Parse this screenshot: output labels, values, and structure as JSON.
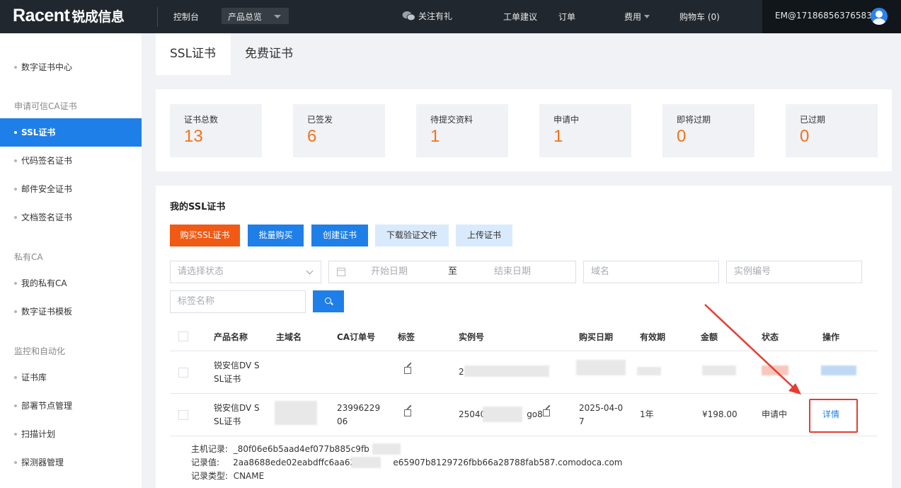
{
  "topbar": {
    "logo_text": "Racent",
    "logo_cn": "锐成信息",
    "console": "控制台",
    "products": "产品总览",
    "wechat": "关注有礼",
    "ticket": "工单建议",
    "orders": "订单",
    "fees": "费用",
    "cart": "购物车 (0)",
    "user": "EM@17186856376583"
  },
  "sidebar": {
    "items": [
      {
        "label": "数字证书中心"
      },
      {
        "group": "申请可信CA证书"
      },
      {
        "label": "SSL证书",
        "active": true
      },
      {
        "label": "代码签名证书"
      },
      {
        "label": "邮件安全证书"
      },
      {
        "label": "文档签名证书"
      },
      {
        "group": "私有CA"
      },
      {
        "label": "我的私有CA"
      },
      {
        "label": "数字证书模板"
      },
      {
        "group": "监控和自动化"
      },
      {
        "label": "证书库"
      },
      {
        "label": "部署节点管理"
      },
      {
        "label": "扫描计划"
      },
      {
        "label": "探测器管理"
      }
    ]
  },
  "tabs": [
    {
      "label": "SSL证书",
      "active": true
    },
    {
      "label": "免费证书",
      "active": false
    }
  ],
  "stats": [
    {
      "label": "证书总数",
      "value": "13"
    },
    {
      "label": "已签发",
      "value": "6"
    },
    {
      "label": "待提交资料",
      "value": "1"
    },
    {
      "label": "申请中",
      "value": "1"
    },
    {
      "label": "即将过期",
      "value": "0"
    },
    {
      "label": "已过期",
      "value": "0"
    }
  ],
  "main": {
    "title": "我的SSL证书",
    "buttons": {
      "buy": "购买SSL证书",
      "bulk": "批量购买",
      "create": "创建证书",
      "download": "下载验证文件",
      "upload": "上传证书"
    },
    "filters": {
      "status_placeholder": "请选择状态",
      "start_date": "开始日期",
      "date_sep": "至",
      "end_date": "结束日期",
      "domain": "域名",
      "instance": "实例编号",
      "tag": "标签名称"
    },
    "columns": [
      "产品名称",
      "主域名",
      "CA订单号",
      "标签",
      "实例号",
      "购买日期",
      "有效期",
      "金额",
      "状态",
      "操作"
    ],
    "rows": [
      {
        "product_line1": "锐安信DV S",
        "product_line2": "SL证书",
        "instance": "2"
      },
      {
        "product_line1": "锐安信DV S",
        "product_line2": "SL证书",
        "ca_order_line1": "23996229",
        "ca_order_line2": "06",
        "instance_a": "25040",
        "instance_b": "go8",
        "date_line1": "2025-04-0",
        "date_line2": "7",
        "validity": "1年",
        "amount": "¥198.00",
        "status": "申请中",
        "action": "详情"
      }
    ],
    "detail": {
      "host_label": "主机记录:",
      "host_value": "_80f06e6b5aad4ef077b885c9fb",
      "value_label": "记录值:",
      "value_a": "2aa8688ede02eabdffc6aa6207",
      "value_b": "e65907b8129726fbb66a28788fab587.comodoca.com",
      "type_label": "记录类型:",
      "type_value": "CNAME"
    }
  },
  "colors": {
    "accent": "#1f7fe8",
    "orange": "#f05a14",
    "annotation": "#e63c32"
  }
}
